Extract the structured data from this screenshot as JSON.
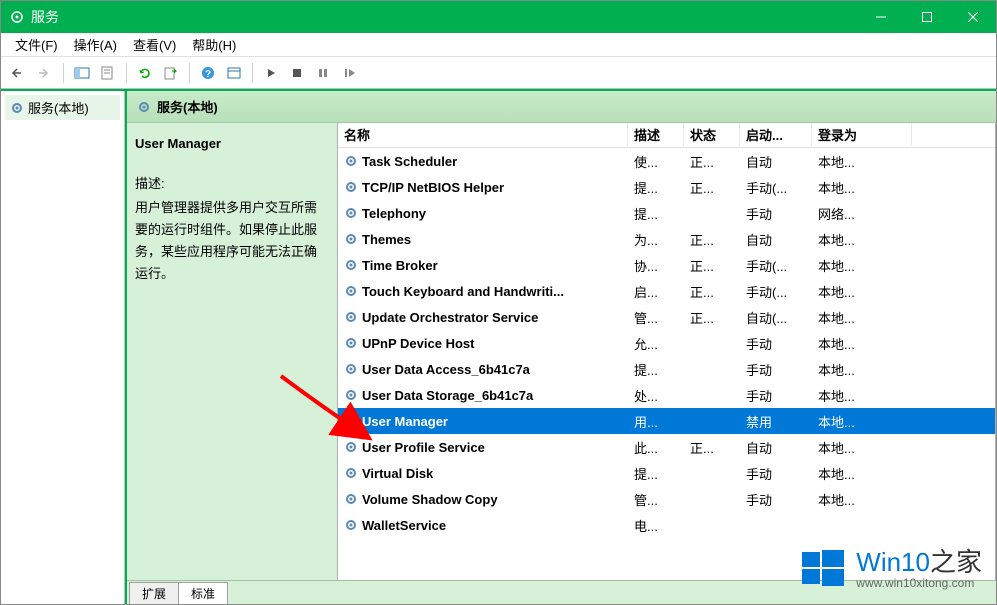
{
  "window": {
    "title": "服务"
  },
  "menubar": {
    "file": "文件(F)",
    "action": "操作(A)",
    "view": "查看(V)",
    "help": "帮助(H)"
  },
  "tree": {
    "root": "服务(本地)"
  },
  "pane_header": "服务(本地)",
  "detail": {
    "title": "User Manager",
    "desc_label": "描述:",
    "desc_text": "用户管理器提供多用户交互所需要的运行时组件。如果停止此服务，某些应用程序可能无法正确运行。"
  },
  "columns": {
    "name": "名称",
    "desc": "描述",
    "status": "状态",
    "startup": "启动...",
    "logon": "登录为"
  },
  "services": [
    {
      "name": "Task Scheduler",
      "desc": "使...",
      "status": "正...",
      "startup": "自动",
      "logon": "本地...",
      "selected": false
    },
    {
      "name": "TCP/IP NetBIOS Helper",
      "desc": "提...",
      "status": "正...",
      "startup": "手动(...",
      "logon": "本地...",
      "selected": false
    },
    {
      "name": "Telephony",
      "desc": "提...",
      "status": "",
      "startup": "手动",
      "logon": "网络...",
      "selected": false
    },
    {
      "name": "Themes",
      "desc": "为...",
      "status": "正...",
      "startup": "自动",
      "logon": "本地...",
      "selected": false
    },
    {
      "name": "Time Broker",
      "desc": "协...",
      "status": "正...",
      "startup": "手动(...",
      "logon": "本地...",
      "selected": false
    },
    {
      "name": "Touch Keyboard and Handwriti...",
      "desc": "启...",
      "status": "正...",
      "startup": "手动(...",
      "logon": "本地...",
      "selected": false
    },
    {
      "name": "Update Orchestrator Service",
      "desc": "管...",
      "status": "正...",
      "startup": "自动(...",
      "logon": "本地...",
      "selected": false
    },
    {
      "name": "UPnP Device Host",
      "desc": "允...",
      "status": "",
      "startup": "手动",
      "logon": "本地...",
      "selected": false
    },
    {
      "name": "User Data Access_6b41c7a",
      "desc": "提...",
      "status": "",
      "startup": "手动",
      "logon": "本地...",
      "selected": false
    },
    {
      "name": "User Data Storage_6b41c7a",
      "desc": "处...",
      "status": "",
      "startup": "手动",
      "logon": "本地...",
      "selected": false
    },
    {
      "name": "User Manager",
      "desc": "用...",
      "status": "",
      "startup": "禁用",
      "logon": "本地...",
      "selected": true
    },
    {
      "name": "User Profile Service",
      "desc": "此...",
      "status": "正...",
      "startup": "自动",
      "logon": "本地...",
      "selected": false
    },
    {
      "name": "Virtual Disk",
      "desc": "提...",
      "status": "",
      "startup": "手动",
      "logon": "本地...",
      "selected": false
    },
    {
      "name": "Volume Shadow Copy",
      "desc": "管...",
      "status": "",
      "startup": "手动",
      "logon": "本地...",
      "selected": false
    },
    {
      "name": "WalletService",
      "desc": "电...",
      "status": "",
      "startup": "",
      "logon": "",
      "selected": false
    }
  ],
  "tabs": {
    "extended": "扩展",
    "standard": "标准"
  },
  "watermark": {
    "brand_a": "Win10",
    "brand_b": "之家",
    "url": "www.win10xitong.com"
  }
}
